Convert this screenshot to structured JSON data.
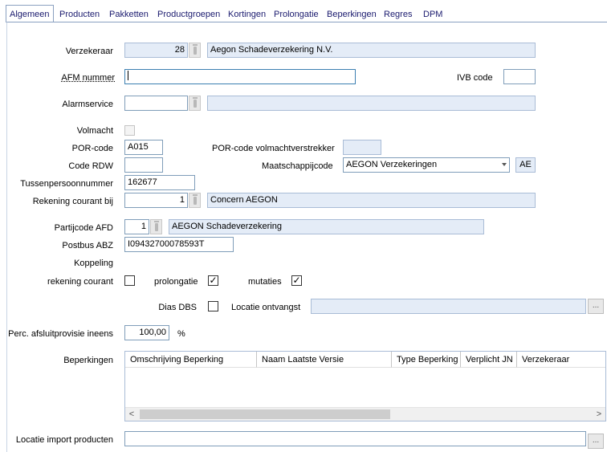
{
  "tabs": [
    "Algemeen",
    "Producten",
    "Pakketten",
    "Productgroepen",
    "Kortingen",
    "Prolongatie",
    "Beperkingen",
    "Regres",
    "DPM"
  ],
  "form": {
    "verzekeraar": {
      "label": "Verzekeraar",
      "code": "28",
      "name": "Aegon Schadeverzekering N.V."
    },
    "afm": {
      "label": "AFM nummer",
      "value": ""
    },
    "ivb": {
      "label": "IVB code",
      "value": ""
    },
    "alarmservice": {
      "label": "Alarmservice",
      "value": "",
      "name": ""
    },
    "volmacht": {
      "label": "Volmacht"
    },
    "por_code": {
      "label": "POR-code",
      "value": "A015"
    },
    "por_volmacht": {
      "label": "POR-code volmachtverstrekker",
      "value": ""
    },
    "code_rdw": {
      "label": "Code RDW",
      "value": ""
    },
    "maatschappij": {
      "label": "Maatschappijcode",
      "value": "AEGON Verzekeringen",
      "short": "AE"
    },
    "tussenpersoon": {
      "label": "Tussenpersoonnummer",
      "value": "162677"
    },
    "rekening_courant_bij": {
      "label": "Rekening courant bij",
      "code": "1",
      "name": "Concern AEGON"
    },
    "partijcode": {
      "label": "Partijcode AFD",
      "code": "1",
      "name": "AEGON Schadeverzekering"
    },
    "postbus": {
      "label": "Postbus ABZ",
      "value": "I09432700078593T"
    },
    "koppeling": {
      "label": "Koppeling"
    },
    "rekening_courant": {
      "label": "rekening courant",
      "checked": false
    },
    "prolongatie": {
      "label": "prolongatie",
      "checked": true
    },
    "mutaties": {
      "label": "mutaties",
      "checked": true
    },
    "dias_dbs": {
      "label": "Dias DBS",
      "checked": false
    },
    "locatie_ontvangst": {
      "label": "Locatie ontvangst",
      "value": ""
    },
    "perc": {
      "label": "Perc. afsluitprovisie ineens",
      "value": "100,00",
      "unit": "%"
    },
    "beperkingen": {
      "label": "Beperkingen",
      "columns": [
        "Omschrijving Beperking",
        "Naam Laatste Versie",
        "Type Beperking",
        "Verplicht JN",
        "Verzekeraar"
      ]
    },
    "locatie_import": {
      "label": "Locatie import producten",
      "value": ""
    }
  },
  "glyphs": {
    "check": "✓",
    "ellipsis": "...",
    "left": "<",
    "right": ">"
  }
}
